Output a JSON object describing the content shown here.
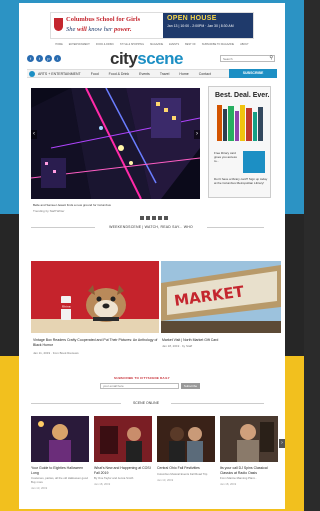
{
  "ad": {
    "school_line": "Columbus School for Girls",
    "tagline_a": "She ",
    "tagline_b": "will",
    "tagline_c": " know her ",
    "tagline_d": "power.",
    "open_house": "OPEN HOUSE",
    "open_house_details": "Jan 13 | 10:00 - 2:00PM  ·  Jan 30 | 8:30 AM"
  },
  "util_nav": [
    "HOME",
    "ENTERTAINMENT",
    "FOOD & DRINK",
    "STYLE & SHOPPING",
    "MAGAZINE",
    "EVENTS",
    "BEST OF",
    "SUBSCRIBE TO MAGAZINE",
    "ABOUT"
  ],
  "social": [
    "f",
    "t",
    "p",
    "i"
  ],
  "logo": {
    "part1": "city",
    "part2": "scene"
  },
  "search": {
    "placeholder": "Search"
  },
  "main_nav": {
    "items": [
      "ARTS + ENTERTAINMENT",
      "Food",
      "Food & Drink",
      "Events",
      "Travel",
      "Home",
      "Contact"
    ],
    "subscribe": "SUBSCRIBE"
  },
  "hero": {
    "caption": "Belle and Samuel Jewett finds a new ground for Columbus",
    "byline": "Trending by Staff Writer"
  },
  "sidebar_ad": {
    "headline": "Best. Deal. Ever.",
    "promo1": "Free library card gives you access to...",
    "promo2": "Don't have a library card? Sign up today at the Columbus Metropolitan Library!"
  },
  "carousel": {
    "dots": 5
  },
  "section_header": "WEEKENDSCENE | WATCH, READ SAY... WHO",
  "features": [
    {
      "title": "Vintage Box Readers Crafty Cooperated and Put Their Pictures: An Anthology of Black Humor",
      "byline": "Jan 11, 2019 · from Book Reviews"
    },
    {
      "title": "Market Visit | North Market Gift Card",
      "byline": "Jan 18, 2019 · by Staff"
    }
  ],
  "market_sign": "MARKET",
  "can_label": "Rhine",
  "subscribe": {
    "heading": "SUBSCRIBE TO CITYSCENE DAILY",
    "input_placeholder": "your email here",
    "button": "Subscribe"
  },
  "scene_online": {
    "heading": "SCENE ONLINE",
    "cards": [
      {
        "title": "Your Guide to Eighties Halloween Long",
        "byline": "Costumes, parties, all the old Halloween good Buy more",
        "date": "Jan 13, 2019"
      },
      {
        "title": "What's New and Happening at COSI Fall 2019",
        "byline": "By One Taylor and Jenna Smith",
        "date": "Jan 18, 2019"
      },
      {
        "title": "Central Ohio Fall Festivities",
        "byline": "Columbus Musical Events Fall Road Trip",
        "date": "Jan 13, 2019"
      },
      {
        "title": "Its your call DJ Spins Classical Classics at Radio Oasis",
        "byline": "From Marine Manning Plant...",
        "date": "Jan 18, 2019"
      }
    ]
  },
  "colors": {
    "accent": "#1c8fc4",
    "brand_red": "#c4262e",
    "bg_blue": "#2c93c4",
    "bg_dark": "#262626",
    "bg_yellow": "#f2c01e"
  }
}
